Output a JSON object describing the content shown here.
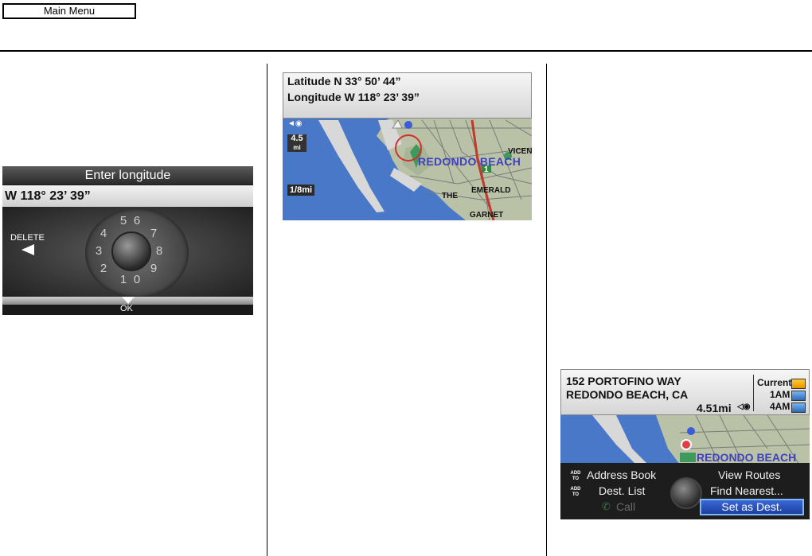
{
  "header": {
    "main_menu_label": "Main Menu"
  },
  "screen_enter_longitude": {
    "title": "Enter longitude",
    "value": "W 118° 23’ 39”",
    "digits": [
      "5",
      "6",
      "4",
      "7",
      "3",
      "8",
      "2",
      "9",
      "1",
      "0"
    ],
    "delete_label": "DELETE",
    "ok_label": "OK"
  },
  "screen_coordinates_map": {
    "latitude": "Latitude N 33° 50’ 44”",
    "longitude": "Longitude W 118° 23’ 39”",
    "distance": "4.5",
    "distance_unit": "mi",
    "scale": "1/8mi",
    "route_shield": "1",
    "map_labels": [
      "REDONDO BEACH",
      "THE",
      "EMERALD",
      "GARNET",
      "VICEN"
    ]
  },
  "screen_destination": {
    "address_line1": "152 PORTOFINO WAY",
    "address_line2": "REDONDO BEACH, CA",
    "distance": "4.51mi",
    "weather": [
      {
        "label": "Current",
        "icon": "sun-icon"
      },
      {
        "label": "1AM",
        "icon": "weather-icon"
      },
      {
        "label": "4AM",
        "icon": "weather-icon"
      }
    ],
    "map_label": "REDONDO BEACH",
    "add_to": "ADD TO",
    "menu": {
      "address_book": "Address Book",
      "dest_list": "Dest. List",
      "call": "Call",
      "view_routes": "View Routes",
      "find_nearest": "Find Nearest...",
      "set_as_dest": "Set as Dest."
    }
  }
}
